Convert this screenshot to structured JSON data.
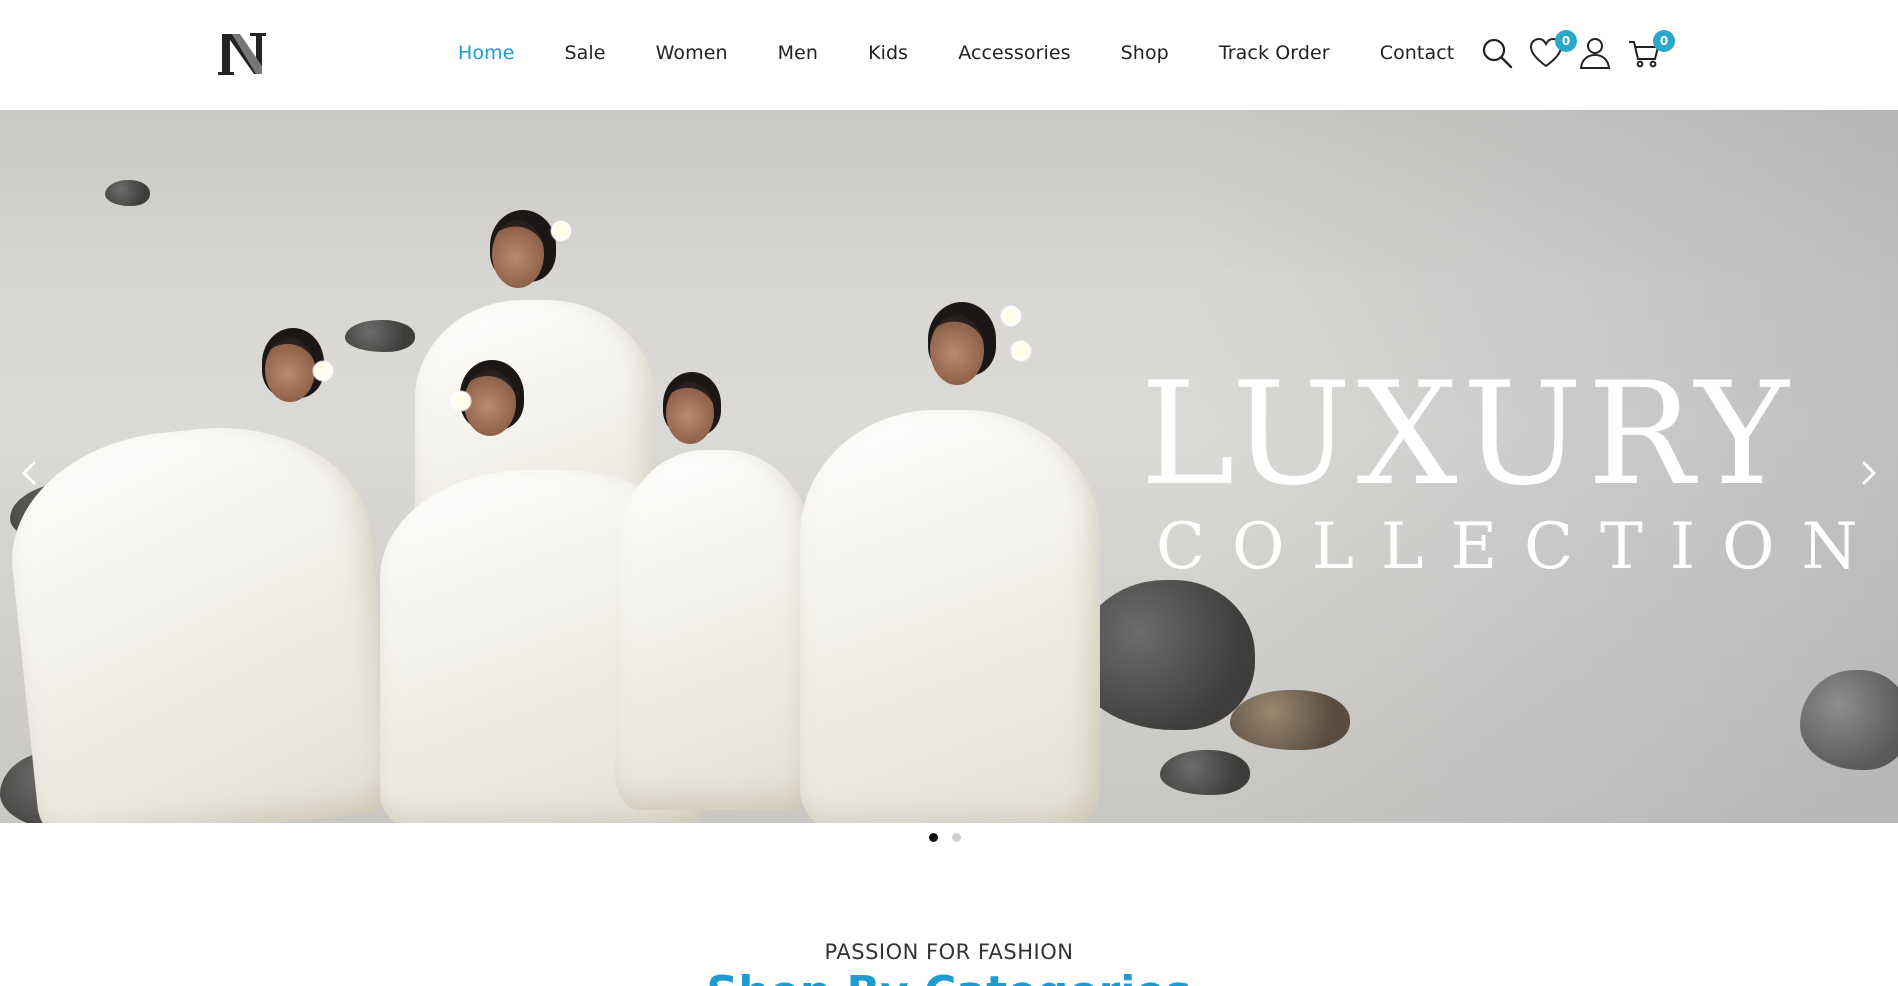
{
  "brand": {
    "logo_letter": "N",
    "accent_color": "#1f9bd1",
    "badge_color": "#29a8c9"
  },
  "nav": {
    "items": [
      {
        "label": "Home",
        "active": true
      },
      {
        "label": "Sale",
        "active": false
      },
      {
        "label": "Women",
        "active": false
      },
      {
        "label": "Men",
        "active": false
      },
      {
        "label": "Kids",
        "active": false
      },
      {
        "label": "Accessories",
        "active": false
      },
      {
        "label": "Shop",
        "active": false
      },
      {
        "label": "Track Order",
        "active": false
      },
      {
        "label": "Contact",
        "active": false
      }
    ]
  },
  "header_icons": {
    "search": {
      "icon": "search-icon"
    },
    "wishlist": {
      "icon": "heart-icon",
      "count": "0"
    },
    "account": {
      "icon": "user-icon"
    },
    "cart": {
      "icon": "cart-icon",
      "count": "0"
    }
  },
  "hero": {
    "title_line1": "LUXURY",
    "title_line2": "COLLECTION",
    "prev_icon": "chevron-left-icon",
    "next_icon": "chevron-right-icon",
    "slides_total": 2,
    "active_slide": 1
  },
  "section": {
    "subtitle": "PASSION FOR FASHION",
    "title": "Shop By Categories"
  }
}
